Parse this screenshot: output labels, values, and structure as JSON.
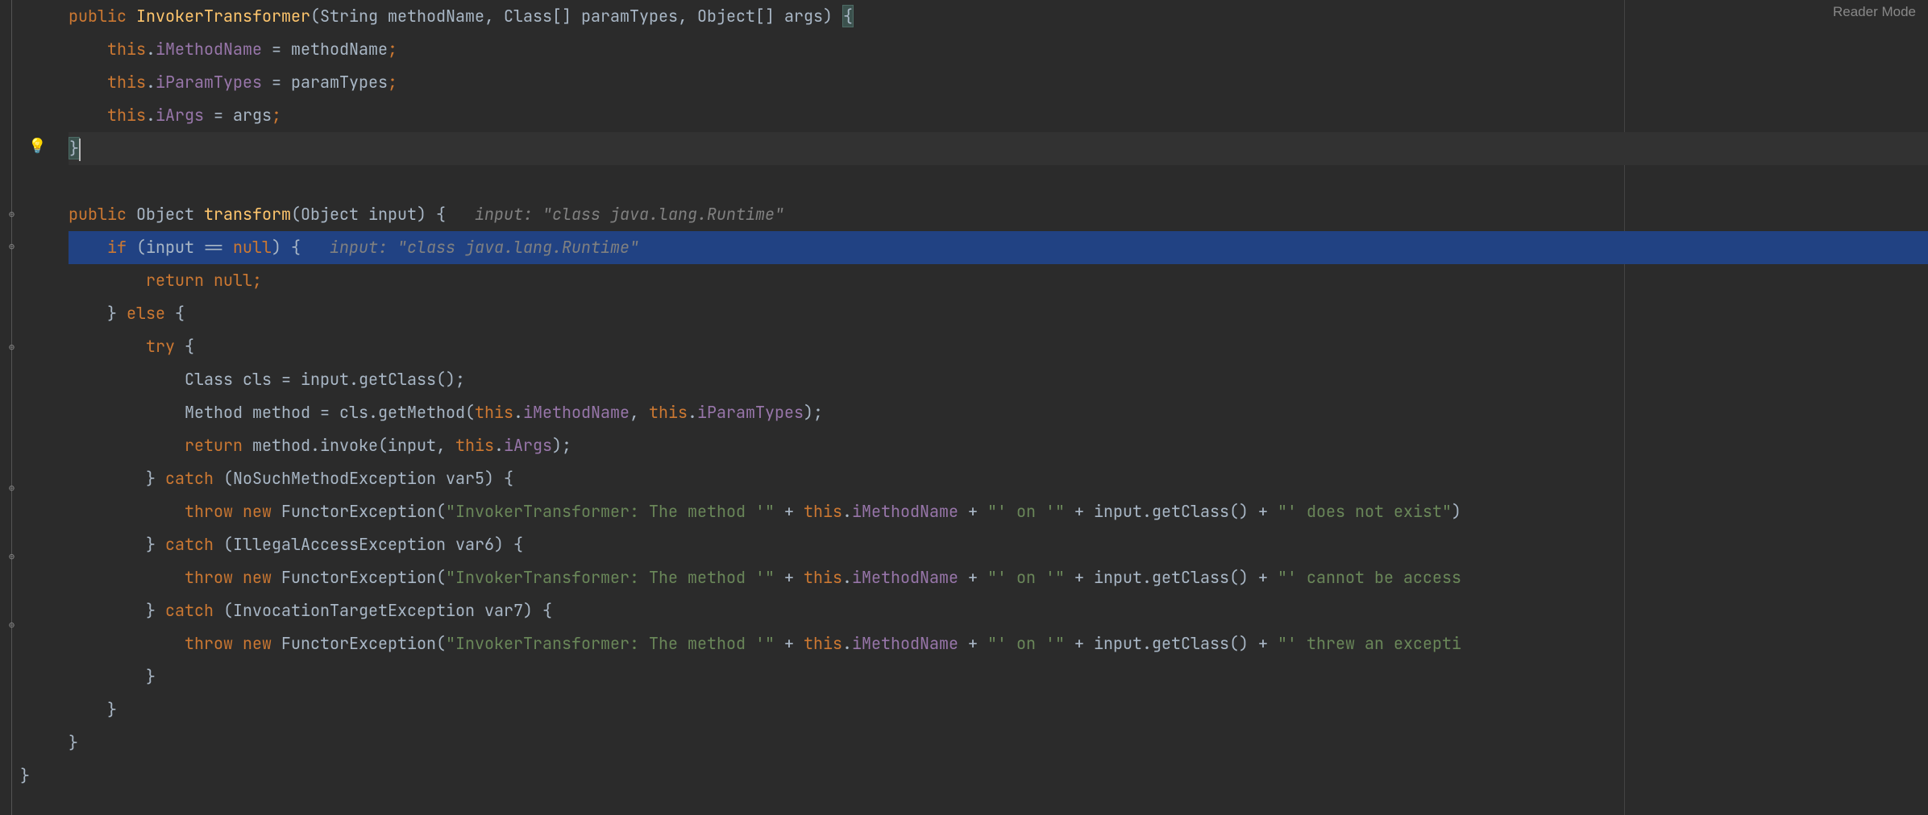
{
  "reader_mode": "Reader Mode",
  "code": {
    "l1": {
      "kw_public": "public",
      "ctor": "InvokerTransformer",
      "sig_open": "(",
      "p_string": "String",
      "p_methodName": " methodName",
      "comma1": ", ",
      "p_class": "Class",
      "brackets1": "[]",
      "p_paramTypes": " paramTypes",
      "comma2": ", ",
      "p_object": "Object",
      "brackets2": "[]",
      "p_args": " args",
      "sig_close": ") ",
      "brace": "{"
    },
    "l2": {
      "this": "this",
      "dot": ".",
      "field": "iMethodName",
      "eq": " = ",
      "rhs": "methodName",
      "semi": ";"
    },
    "l3": {
      "this": "this",
      "dot": ".",
      "field": "iParamTypes",
      "eq": " = ",
      "rhs": "paramTypes",
      "semi": ";"
    },
    "l4": {
      "this": "this",
      "dot": ".",
      "field": "iArgs",
      "eq": " = ",
      "rhs": "args",
      "semi": ";"
    },
    "l5": {
      "brace": "}"
    },
    "l7": {
      "kw_public": "public",
      "ret": " Object ",
      "name": "transform",
      "sig": "(Object input) {   ",
      "hint": "input: \"class java.lang.Runtime\""
    },
    "l8": {
      "kw_if": "if",
      "open": " (input ",
      "eqeq": "==",
      "nul": " null",
      "close": ") {   ",
      "hint": "input: \"class java.lang.Runtime\""
    },
    "l9": {
      "kw_return": "return",
      "nul": " null",
      "semi": ";"
    },
    "l10": {
      "brace": "} ",
      "kw_else": "else",
      "brace2": " {"
    },
    "l11": {
      "kw_try": "try",
      "brace": " {"
    },
    "l12": {
      "type": "Class",
      "var": " cls = input.getClass();"
    },
    "l13": {
      "type": "Method",
      "pre": " method = cls.getMethod(",
      "this1": "this",
      "dot1": ".",
      "f1": "iMethodName",
      "comma": ", ",
      "this2": "this",
      "dot2": ".",
      "f2": "iParamTypes",
      "post": ");"
    },
    "l14": {
      "kw_return": "return",
      "pre": " method.invoke(input, ",
      "this": "this",
      "dot": ".",
      "f": "iArgs",
      "post": ");"
    },
    "l15": {
      "brace": "} ",
      "kw_catch": "catch",
      "sig": " (NoSuchMethodException var5) {"
    },
    "l16": {
      "kw_throw": "throw",
      "kw_new": " new ",
      "ex": "FunctorException(",
      "s1": "\"InvokerTransformer: The method '\"",
      "plus1": " + ",
      "this1": "this",
      "dot1": ".",
      "f1": "iMethodName",
      "plus2": " + ",
      "s2": "\"' on '\"",
      "plus3": " + input.getClass() + ",
      "s3": "\"' does not exist\"",
      "close": ")"
    },
    "l17": {
      "brace": "} ",
      "kw_catch": "catch",
      "sig": " (IllegalAccessException var6) {"
    },
    "l18": {
      "kw_throw": "throw",
      "kw_new": " new ",
      "ex": "FunctorException(",
      "s1": "\"InvokerTransformer: The method '\"",
      "plus1": " + ",
      "this1": "this",
      "dot1": ".",
      "f1": "iMethodName",
      "plus2": " + ",
      "s2": "\"' on '\"",
      "plus3": " + input.getClass() + ",
      "s3": "\"' cannot be access",
      "close": ""
    },
    "l19": {
      "brace": "} ",
      "kw_catch": "catch",
      "sig": " (InvocationTargetException var7) {"
    },
    "l20": {
      "kw_throw": "throw",
      "kw_new": " new ",
      "ex": "FunctorException(",
      "s1": "\"InvokerTransformer: The method '\"",
      "plus1": " + ",
      "this1": "this",
      "dot1": ".",
      "f1": "iMethodName",
      "plus2": " + ",
      "s2": "\"' on '\"",
      "plus3": " + input.getClass() + ",
      "s3": "\"' threw an excepti",
      "close": ""
    },
    "l21": {
      "brace": "}"
    },
    "l22": {
      "brace": "}"
    },
    "l23": {
      "brace": "}"
    },
    "l24": {
      "brace": "}"
    }
  }
}
